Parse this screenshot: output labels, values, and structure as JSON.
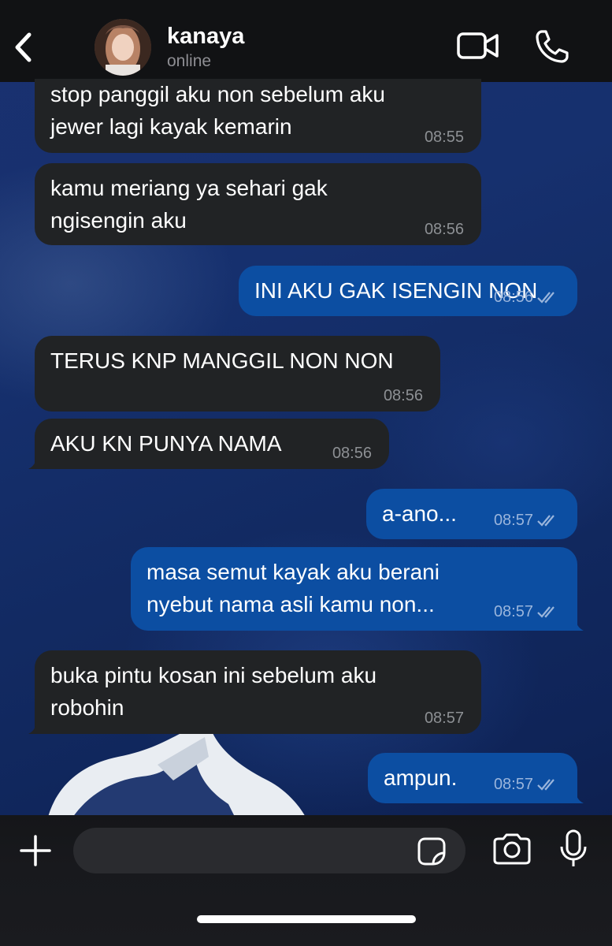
{
  "header": {
    "contact_name": "kanaya",
    "contact_status": "online",
    "icons": {
      "back": "chevron-left-icon",
      "video": "video-camera-icon",
      "call": "phone-icon"
    }
  },
  "messages": [
    {
      "direction": "in",
      "lines": [
        "stop panggil aku non sebelum aku",
        "jewer lagi kayak kemarin"
      ],
      "time": "08:55"
    },
    {
      "direction": "in",
      "lines": [
        "kamu meriang ya sehari gak",
        "ngisengin aku"
      ],
      "time": "08:56"
    },
    {
      "direction": "out",
      "lines": [
        "INI AKU GAK ISENGIN NON"
      ],
      "time": "08:56",
      "read": true
    },
    {
      "direction": "in",
      "lines": [
        "TERUS KNP MANGGIL NON NON"
      ],
      "time": "08:56"
    },
    {
      "direction": "in",
      "lines": [
        "AKU KN PUNYA NAMA"
      ],
      "time": "08:56"
    },
    {
      "direction": "out",
      "lines": [
        "a-ano..."
      ],
      "time": "08:57",
      "read": true
    },
    {
      "direction": "out",
      "lines": [
        "masa semut kayak aku berani",
        "nyebut nama asli kamu non..."
      ],
      "time": "08:57",
      "read": true
    },
    {
      "direction": "in",
      "lines": [
        "buka pintu kosan ini sebelum aku",
        "robohin"
      ],
      "time": "08:57"
    },
    {
      "direction": "out",
      "lines": [
        "ampun."
      ],
      "time": "08:57",
      "read": true
    }
  ],
  "composer": {
    "input_value": "",
    "icons": {
      "add": "plus-icon",
      "sticker": "sticker-icon",
      "camera": "camera-icon",
      "mic": "microphone-icon"
    }
  },
  "colors": {
    "incoming_bubble": "#212325",
    "outgoing_bubble": "#0c4ea2",
    "header_bg": "#111214",
    "timestamp": "#8d9094"
  }
}
